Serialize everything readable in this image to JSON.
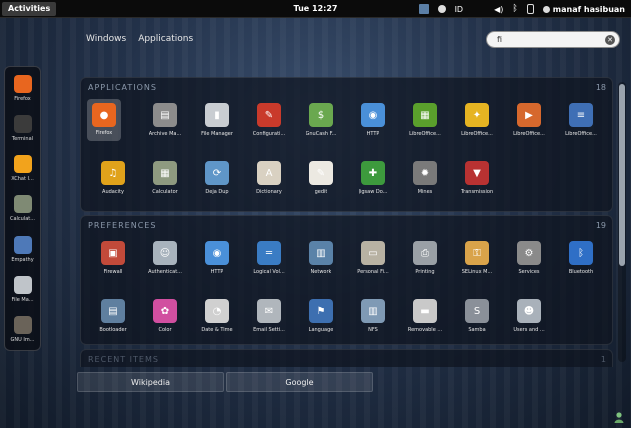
{
  "topbar": {
    "activities": "Activities",
    "clock": "Tue 12:27",
    "indicator_id": "ID",
    "user_name": "manaf hasibuan"
  },
  "views": {
    "windows": "Windows",
    "applications": "Applications"
  },
  "search": {
    "value": "fi"
  },
  "dash": {
    "items": [
      {
        "label": "Firefox",
        "icon": "firefox-icon",
        "color": "#e8661f"
      },
      {
        "label": "Terminal",
        "icon": "terminal-icon",
        "color": "#3b3b3b"
      },
      {
        "label": "XChat I...",
        "icon": "xchat-icon",
        "color": "#f2a31c"
      },
      {
        "label": "Calculat...",
        "icon": "calculator-icon",
        "color": "#7f8a74"
      },
      {
        "label": "Empathy",
        "icon": "empathy-icon",
        "color": "#4e79b8"
      },
      {
        "label": "File Ma...",
        "icon": "file-manager-icon",
        "color": "#bfc4c9"
      },
      {
        "label": "GNU Im...",
        "icon": "gimp-icon",
        "color": "#6a6359"
      }
    ]
  },
  "applications": {
    "heading": "APPLICATIONS",
    "count": "18",
    "items": [
      {
        "label": "Firefox",
        "icon": "firefox-icon",
        "color": "#e8661f",
        "glyph": "●"
      },
      {
        "label": "Archive Ma...",
        "icon": "archive-manager-icon",
        "color": "#8c8c8c",
        "glyph": "▤"
      },
      {
        "label": "File Manager",
        "icon": "file-manager-icon",
        "color": "#c9cdd2",
        "glyph": "▮"
      },
      {
        "label": "Configurati...",
        "icon": "configuration-icon",
        "color": "#c93a2b",
        "glyph": "✎"
      },
      {
        "label": "GnuCash F...",
        "icon": "gnucash-icon",
        "color": "#6aa84f",
        "glyph": "$"
      },
      {
        "label": "HTTP",
        "icon": "http-icon",
        "color": "#4a90d9",
        "glyph": "◉"
      },
      {
        "label": "LibreOffice...",
        "icon": "libreoffice-calc-icon",
        "color": "#5aa02c",
        "glyph": "▦"
      },
      {
        "label": "LibreOffice...",
        "icon": "libreoffice-draw-icon",
        "color": "#e6b422",
        "glyph": "✦"
      },
      {
        "label": "LibreOffice...",
        "icon": "libreoffice-impress-icon",
        "color": "#d6682d",
        "glyph": "▶"
      },
      {
        "label": "LibreOffice...",
        "icon": "libreoffice-writer-icon",
        "color": "#3f6fb5",
        "glyph": "≡"
      },
      {
        "label": "Audacity",
        "icon": "audacity-icon",
        "color": "#e0a21b",
        "glyph": "♫"
      },
      {
        "label": "Calculator",
        "icon": "calculator-icon",
        "color": "#8e9a80",
        "glyph": "▦"
      },
      {
        "label": "Deja Dup",
        "icon": "deja-dup-icon",
        "color": "#5f96c8",
        "glyph": "⟳"
      },
      {
        "label": "Dictionary",
        "icon": "dictionary-icon",
        "color": "#d9d1c2",
        "glyph": "A"
      },
      {
        "label": "gedit",
        "icon": "gedit-icon",
        "color": "#ece9e2",
        "glyph": "✎"
      },
      {
        "label": "Jigsaw Do...",
        "icon": "jigsaw-icon",
        "color": "#3d9a3d",
        "glyph": "✚"
      },
      {
        "label": "Mines",
        "icon": "mines-icon",
        "color": "#7a7a7a",
        "glyph": "✹"
      },
      {
        "label": "Transmission",
        "icon": "transmission-icon",
        "color": "#b83232",
        "glyph": "▼"
      }
    ]
  },
  "preferences": {
    "heading": "PREFERENCES",
    "count": "19",
    "items": [
      {
        "label": "Firewall",
        "icon": "firewall-icon",
        "color": "#c24a3a",
        "glyph": "▣"
      },
      {
        "label": "Authenticat...",
        "icon": "authentication-icon",
        "color": "#a8b3bd",
        "glyph": "☺"
      },
      {
        "label": "HTTP",
        "icon": "http-icon",
        "color": "#4a90d9",
        "glyph": "◉"
      },
      {
        "label": "Logical Vol...",
        "icon": "logical-volume-icon",
        "color": "#3a7cc4",
        "glyph": "═"
      },
      {
        "label": "Network",
        "icon": "network-icon",
        "color": "#5a82a8",
        "glyph": "▥"
      },
      {
        "label": "Personal Fi...",
        "icon": "personal-files-icon",
        "color": "#b8b2a3",
        "glyph": "▭"
      },
      {
        "label": "Printing",
        "icon": "printing-icon",
        "color": "#9aa0a6",
        "glyph": "⎙"
      },
      {
        "label": "SELinux M...",
        "icon": "selinux-icon",
        "color": "#d9a34a",
        "glyph": "⚿"
      },
      {
        "label": "Services",
        "icon": "services-icon",
        "color": "#8a8a8a",
        "glyph": "⚙"
      },
      {
        "label": "Bluetooth",
        "icon": "bluetooth-icon",
        "color": "#2f6fc6",
        "glyph": "ᛒ"
      },
      {
        "label": "Bootloader",
        "icon": "bootloader-icon",
        "color": "#5f7f9f",
        "glyph": "▤"
      },
      {
        "label": "Color",
        "icon": "color-icon",
        "color": "#d14fa0",
        "glyph": "✿"
      },
      {
        "label": "Date & Time",
        "icon": "date-time-icon",
        "color": "#d0d0d0",
        "glyph": "◔"
      },
      {
        "label": "Email Setti...",
        "icon": "email-settings-icon",
        "color": "#b0b6bc",
        "glyph": "✉"
      },
      {
        "label": "Language",
        "icon": "language-icon",
        "color": "#3d6fb0",
        "glyph": "⚑"
      },
      {
        "label": "NFS",
        "icon": "nfs-icon",
        "color": "#7f9ab5",
        "glyph": "▥"
      },
      {
        "label": "Removable ...",
        "icon": "removable-media-icon",
        "color": "#c9c9c9",
        "glyph": "▬"
      },
      {
        "label": "Samba",
        "icon": "samba-icon",
        "color": "#8a9099",
        "glyph": "S"
      },
      {
        "label": "Users and ...",
        "icon": "users-groups-icon",
        "color": "#a9b1ba",
        "glyph": "☻"
      }
    ]
  },
  "recent": {
    "heading": "RECENT ITEMS",
    "count": "1"
  },
  "providers": {
    "wikipedia": "Wikipedia",
    "google": "Google"
  }
}
